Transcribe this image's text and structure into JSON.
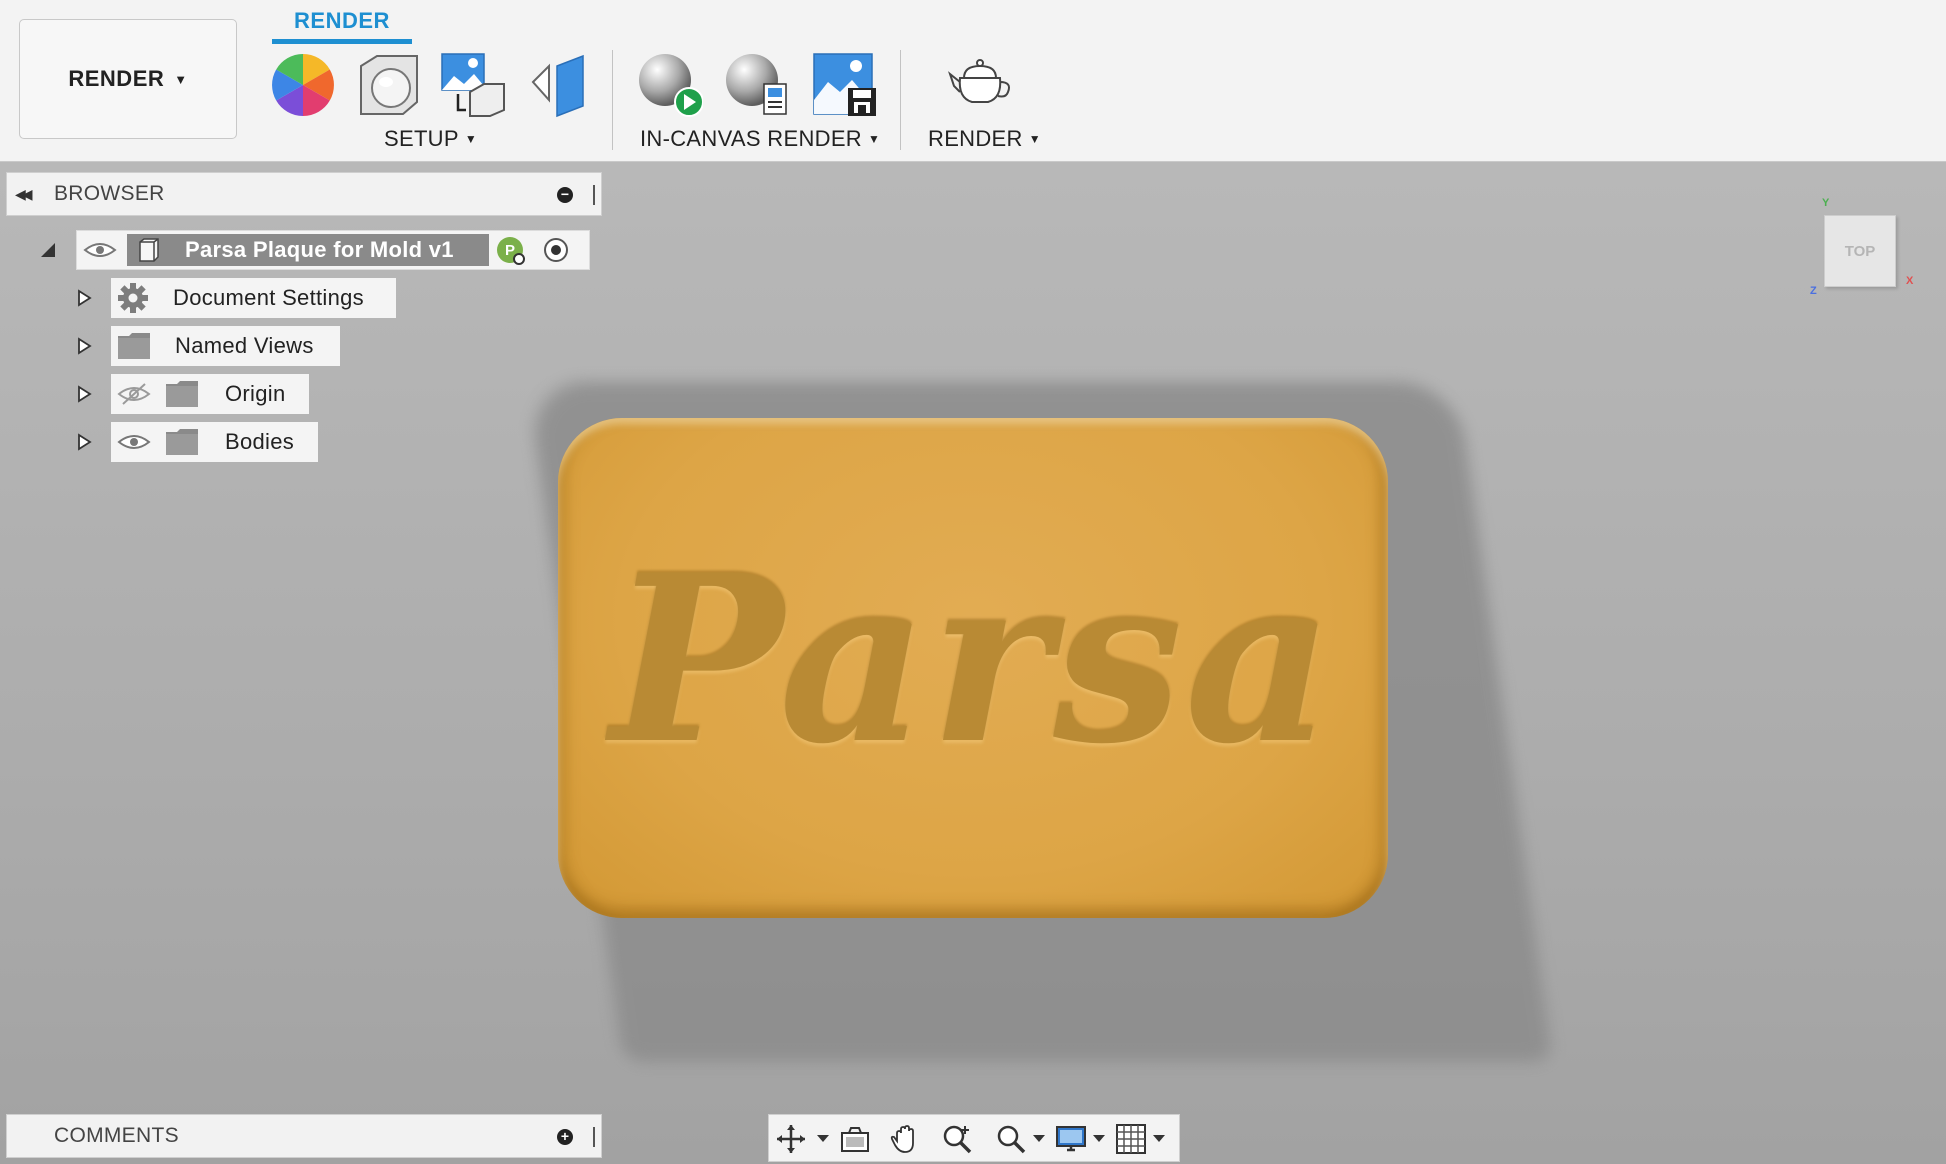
{
  "toolbar": {
    "workspace_label": "RENDER",
    "active_tab": "RENDER",
    "groups": [
      {
        "label": "SETUP",
        "tools": [
          "appearance-icon",
          "scene-settings-icon",
          "texture-map-icon",
          "decal-icon"
        ]
      },
      {
        "label": "IN-CANVAS RENDER",
        "tools": [
          "in-canvas-render-icon",
          "in-canvas-render-settings-icon",
          "capture-image-icon"
        ]
      },
      {
        "label": "RENDER",
        "tools": [
          "render-teapot-icon"
        ]
      }
    ]
  },
  "browser": {
    "title": "BROWSER",
    "root": {
      "label": "Parsa Plaque for Mold v1",
      "badge": "P"
    },
    "nodes": [
      {
        "label": "Document Settings",
        "icon": "gear-icon"
      },
      {
        "label": "Named Views",
        "icon": "folder-icon"
      },
      {
        "label": "Origin",
        "icon": "folder-icon",
        "visibility": "hidden"
      },
      {
        "label": "Bodies",
        "icon": "folder-icon",
        "visibility": "visible"
      }
    ]
  },
  "viewport": {
    "model_text": "Parsa",
    "model_color": "#dda546",
    "view_cube": {
      "face": "TOP",
      "axis_x": "X",
      "axis_y": "Y",
      "axis_z": "Z"
    }
  },
  "comments": {
    "title": "COMMENTS"
  },
  "navbar": {
    "tools": [
      "orbit-icon",
      "look-at-icon",
      "pan-icon",
      "zoom-icon",
      "fit-icon",
      "display-settings-icon",
      "grid-icon"
    ]
  },
  "colors": {
    "accent": "#1e8fd1",
    "toolbar_bg": "#f3f3f3",
    "viewport_bg": "#ababab"
  }
}
